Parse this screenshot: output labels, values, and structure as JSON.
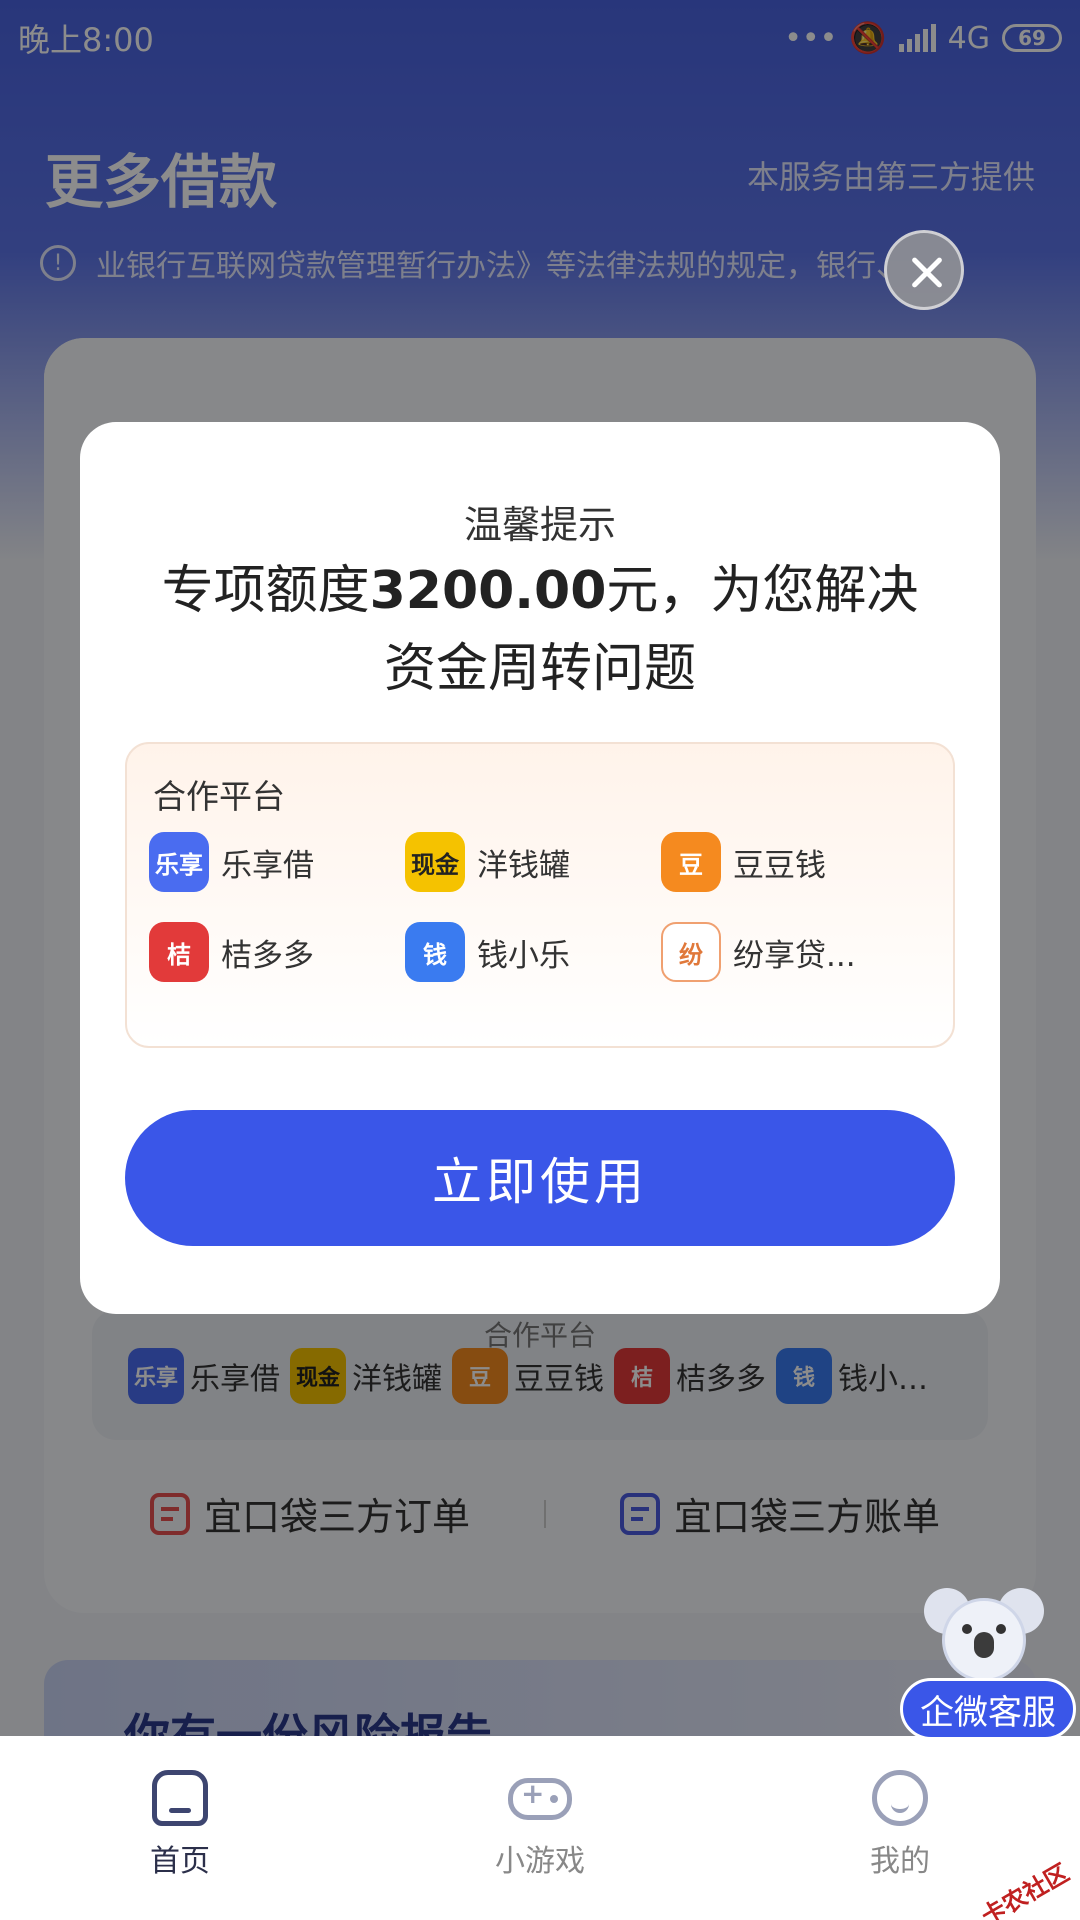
{
  "status_bar": {
    "time": "晚上8:00",
    "network": "4G",
    "battery": "69"
  },
  "page": {
    "title": "更多借款",
    "subtitle": "本服务由第三方提供",
    "notice": "业银行互联网贷款管理暂行办法》等法律法规的规定，银行、"
  },
  "background": {
    "strip_title": "合作平台",
    "strip_items": [
      {
        "name": "乐享借",
        "logo": "乐享",
        "color": "#4a6cf0"
      },
      {
        "name": "洋钱罐",
        "logo": "现金",
        "color": "#f5c200"
      },
      {
        "name": "豆豆钱",
        "logo": "豆",
        "color": "#f58a1f"
      },
      {
        "name": "桔多多",
        "logo": "桔",
        "color": "#e23a3a"
      },
      {
        "name": "钱小…",
        "logo": "钱",
        "color": "#3a7bf0"
      }
    ],
    "orders_link": "宜口袋三方订单",
    "bills_link": "宜口袋三方账单",
    "banner_text": "你有一份风险报告"
  },
  "modal": {
    "title": "温馨提示",
    "headline_prefix": "专项额度",
    "amount": "3200.00",
    "headline_suffix": "元，为您解决资金周转问题",
    "platforms_title": "合作平台",
    "platforms": [
      {
        "name": "乐享借",
        "logo": "乐享",
        "color": "#4a6cf0"
      },
      {
        "name": "洋钱罐",
        "logo": "现金",
        "color": "#f5c200"
      },
      {
        "name": "豆豆钱",
        "logo": "豆",
        "color": "#f58a1f"
      },
      {
        "name": "桔多多",
        "logo": "桔",
        "color": "#e23a3a"
      },
      {
        "name": "钱小乐",
        "logo": "钱",
        "color": "#3a7bf0"
      },
      {
        "name": "纷享贷...",
        "logo": "纷",
        "color": "#f0a070"
      }
    ],
    "button": "立即使用"
  },
  "service": {
    "label": "企微客服"
  },
  "tabs": [
    {
      "label": "首页",
      "icon": "home-icon",
      "active": true
    },
    {
      "label": "小游戏",
      "icon": "gamepad-icon",
      "active": false
    },
    {
      "label": "我的",
      "icon": "profile-icon",
      "active": false
    }
  ],
  "watermark": "卡农社区"
}
